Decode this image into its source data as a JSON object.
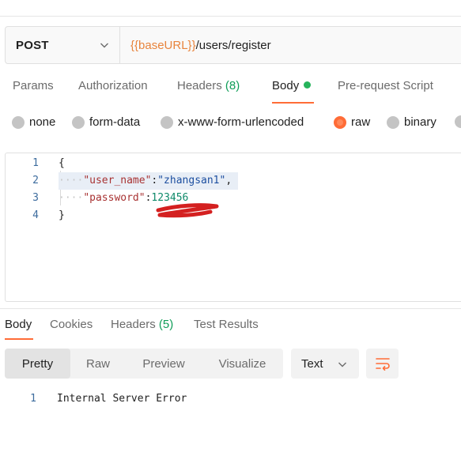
{
  "request": {
    "method": "POST",
    "url_variable": "{{baseURL}}",
    "url_path": "/users/register"
  },
  "request_tabs": [
    {
      "label": "Params"
    },
    {
      "label": "Authorization"
    },
    {
      "label": "Headers ",
      "count": "(8)"
    },
    {
      "label": "Body",
      "active": true
    },
    {
      "label": "Pre-request Script"
    }
  ],
  "body_types": [
    {
      "label": "none"
    },
    {
      "label": "form-data"
    },
    {
      "label": "x-www-form-urlencoded"
    },
    {
      "label": "raw",
      "checked": true
    },
    {
      "label": "binary"
    }
  ],
  "editor": {
    "line_numbers": [
      "1",
      "2",
      "3",
      "4"
    ],
    "open_brace": "{",
    "key_user_name": "\"user_name\"",
    "value_user_name": "\"zhangsan1\"",
    "key_password": "\"password\"",
    "value_password": "123456",
    "close_brace": "}"
  },
  "response_tabs": [
    {
      "label": "Body",
      "active": true
    },
    {
      "label": "Cookies"
    },
    {
      "label": "Headers ",
      "count": "(5)"
    },
    {
      "label": "Test Results"
    }
  ],
  "view_modes": [
    "Pretty",
    "Raw",
    "Preview",
    "Visualize"
  ],
  "active_view_mode": "Pretty",
  "format": "Text",
  "response": {
    "line_number": "1",
    "text": "Internal Server Error"
  },
  "colors": {
    "accent": "#ff6c37",
    "url_variable": "#e8843c",
    "count_green": "#0f9d58",
    "annotation_red": "#d42020"
  }
}
